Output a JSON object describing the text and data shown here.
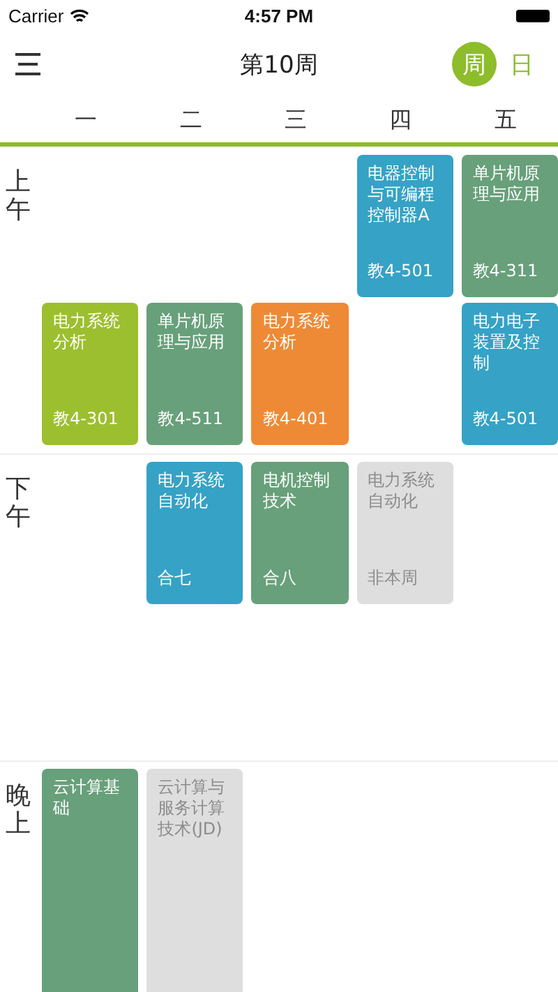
{
  "status_bar": {
    "carrier": "Carrier",
    "time": "4:57 PM"
  },
  "nav": {
    "title": "第10周",
    "view_options": [
      {
        "label": "周",
        "selected": true
      },
      {
        "label": "日",
        "selected": false
      }
    ]
  },
  "weekdays": [
    "一",
    "二",
    "三",
    "四",
    "五"
  ],
  "sections": [
    {
      "label": "上午",
      "rows": [
        {
          "cells": [
            {
              "kind": "empty"
            },
            {
              "kind": "empty"
            },
            {
              "kind": "empty"
            },
            {
              "kind": "course",
              "name": "电器控制与可编程控制器A",
              "room": "教4-501",
              "color": "#35a2c6",
              "this_week": true
            },
            {
              "kind": "course",
              "name": "单片机原理与应用",
              "room": "教4-311",
              "color": "#67a07a",
              "this_week": true
            }
          ]
        },
        {
          "cells": [
            {
              "kind": "course",
              "name": "电力系统分析",
              "room": "教4-301",
              "color": "#9cbf2f",
              "this_week": true
            },
            {
              "kind": "course",
              "name": "单片机原理与应用",
              "room": "教4-511",
              "color": "#67a07a",
              "this_week": true
            },
            {
              "kind": "course",
              "name": "电力系统分析",
              "room": "教4-401",
              "color": "#ee8a35",
              "this_week": true
            },
            {
              "kind": "empty"
            },
            {
              "kind": "course",
              "name": "电力电子装置及控制",
              "room": "教4-501",
              "color": "#35a2c6",
              "this_week": true
            }
          ]
        }
      ]
    },
    {
      "label": "下午",
      "rows": [
        {
          "cells": [
            {
              "kind": "empty"
            },
            {
              "kind": "course",
              "name": "电力系统自动化",
              "room": "合七",
              "color": "#35a2c6",
              "this_week": true
            },
            {
              "kind": "course",
              "name": "电机控制技术",
              "room": "合八",
              "color": "#67a07a",
              "this_week": true
            },
            {
              "kind": "course",
              "name": "电力系统自动化",
              "room": "非本周",
              "this_week": false
            },
            {
              "kind": "empty"
            }
          ]
        },
        {
          "cells": [
            {
              "kind": "empty"
            },
            {
              "kind": "empty"
            },
            {
              "kind": "empty"
            },
            {
              "kind": "empty"
            },
            {
              "kind": "empty"
            }
          ]
        }
      ]
    },
    {
      "label": "晚上",
      "rows": [
        {
          "cells": [
            {
              "kind": "course",
              "name": "云计算基础",
              "color": "#67a07a",
              "this_week": true
            },
            {
              "kind": "course",
              "name": "云计算与服务计算技术(JD)",
              "this_week": false
            },
            {
              "kind": "empty"
            },
            {
              "kind": "empty"
            },
            {
              "kind": "empty"
            }
          ]
        }
      ]
    }
  ]
}
